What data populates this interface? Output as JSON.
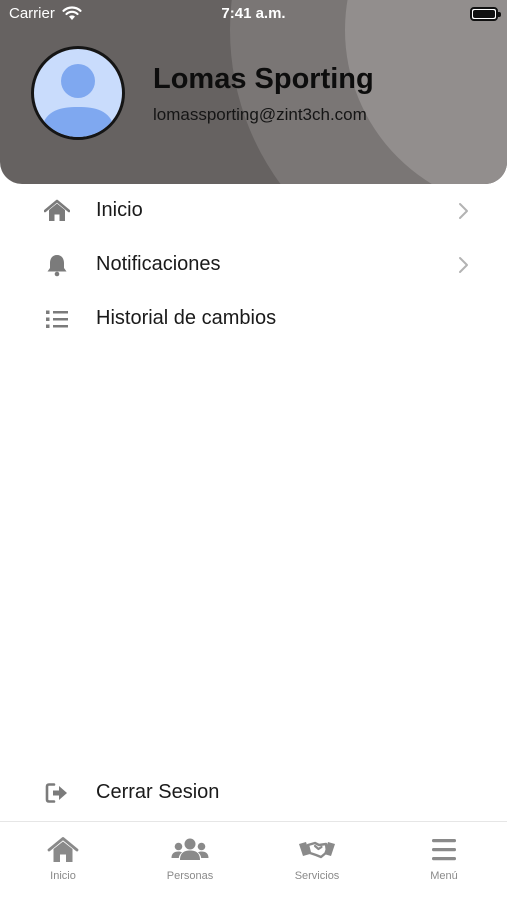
{
  "status_bar": {
    "carrier": "Carrier",
    "time": "7:41 a.m."
  },
  "profile": {
    "name": "Lomas Sporting",
    "email": "lomassporting@zint3ch.com"
  },
  "menu": {
    "items": [
      {
        "label": "Inicio",
        "icon": "home-icon"
      },
      {
        "label": "Notificaciones",
        "icon": "bell-icon"
      },
      {
        "label": "Historial de cambios",
        "icon": "list-icon"
      }
    ],
    "logout": {
      "label": "Cerrar Sesion",
      "icon": "sign-out-icon"
    }
  },
  "tab_bar": {
    "tabs": [
      {
        "label": "Inicio",
        "icon": "home-icon"
      },
      {
        "label": "Personas",
        "icon": "users-icon"
      },
      {
        "label": "Servicios",
        "icon": "handshake-icon"
      },
      {
        "label": "Menú",
        "icon": "hamburger-icon"
      }
    ]
  },
  "colors": {
    "header": "#666261",
    "icon_gray": "#7b7b7b",
    "text": "#1a1a1a"
  }
}
